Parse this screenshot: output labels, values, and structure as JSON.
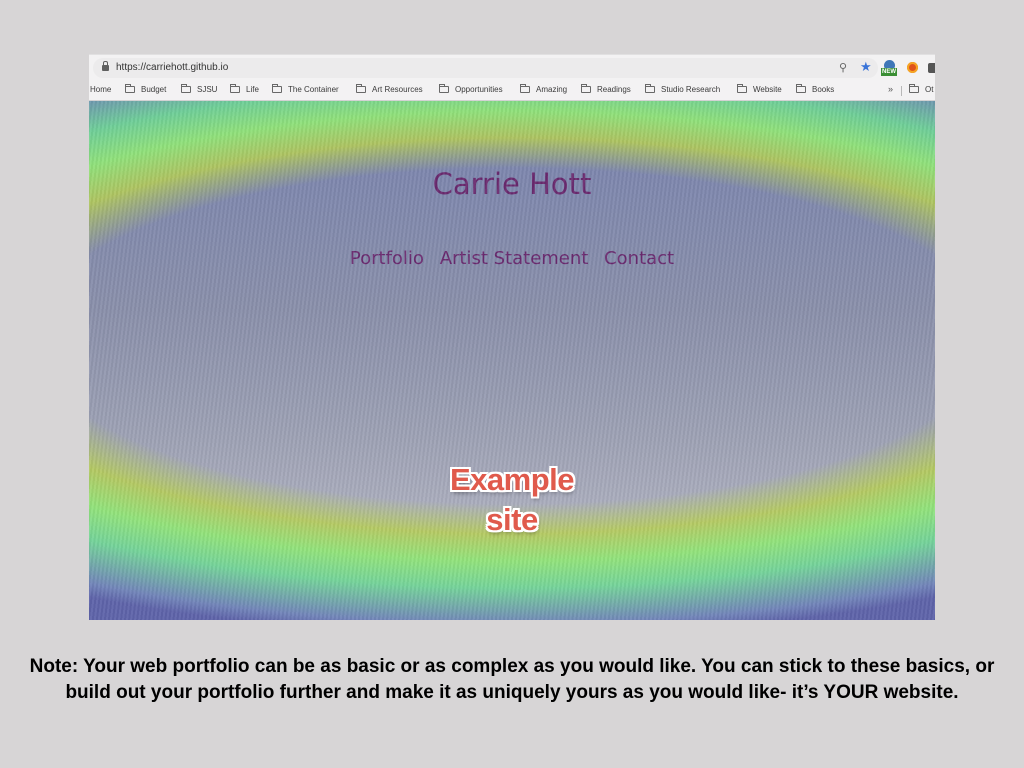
{
  "browser": {
    "url": "https://carriehott.github.io",
    "icons": [
      "lock-icon",
      "search-icon",
      "bookmark-star-icon",
      "extension-new-icon",
      "extension-orange-icon",
      "extension-dark-icon"
    ],
    "extension_badge": "NEW",
    "bookmarks": [
      "Home",
      "Budget",
      "SJSU",
      "Life",
      "The Container",
      "Art Resources",
      "Opportunities",
      "Amazing",
      "Readings",
      "Studio Research",
      "Website",
      "Books"
    ],
    "more_label": "»",
    "other_label": "Ot"
  },
  "site": {
    "title": "Carrie Hott",
    "nav": [
      "Portfolio",
      "Artist Statement",
      "Contact"
    ]
  },
  "annotation": {
    "line1": "Example",
    "line2": "site",
    "color": "#e05a4c"
  },
  "note": "Note: Your web portfolio can be as basic or as complex as you would like. You can stick to these basics, or build out your portfolio further and make it as uniquely yours as you would like- it’s YOUR website.",
  "colors": {
    "slide_background": "#d7d5d6",
    "site_text": "#6a2a6f"
  }
}
